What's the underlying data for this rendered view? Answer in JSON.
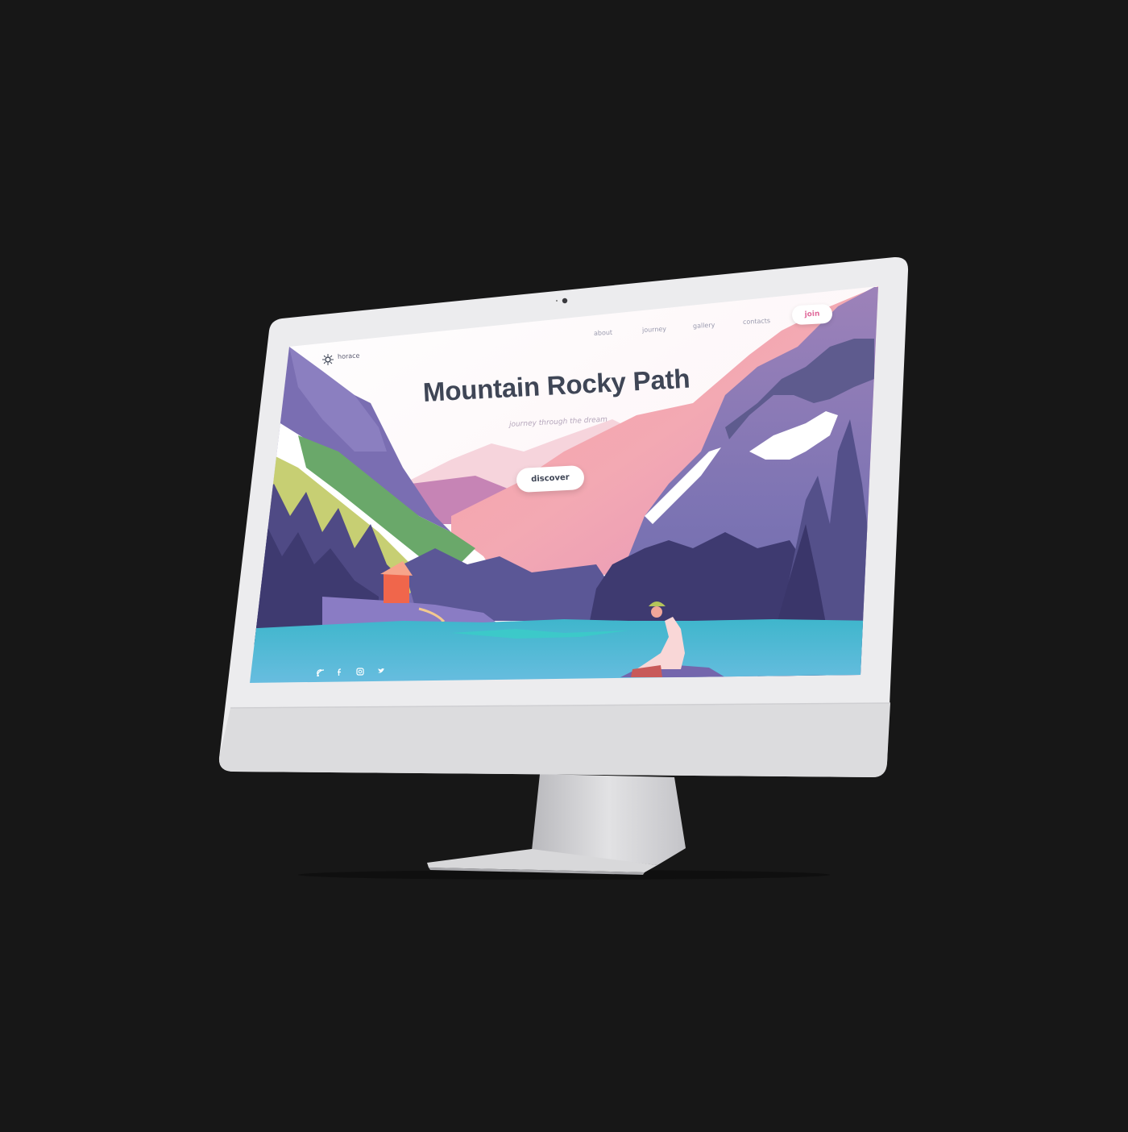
{
  "site": {
    "brand": "horace",
    "nav": [
      "about",
      "journey",
      "gallery",
      "contacts"
    ],
    "join_label": "join",
    "hero_title": "Mountain Rocky Path",
    "hero_subtitle": "journey through the dream",
    "discover_label": "discover",
    "social_icons": [
      "rss-icon",
      "facebook-icon",
      "instagram-icon",
      "twitter-icon"
    ]
  },
  "colors": {
    "background": "#171717",
    "bezel": "#e9e9eb",
    "chin": "#d9d9db",
    "sky": "#ffffff",
    "pink_mountain": "#f29aa6",
    "purple_mountain": "#6e6aa8",
    "lake": "#56bcd6",
    "accent": "#e0699a",
    "title": "#3f4656"
  }
}
